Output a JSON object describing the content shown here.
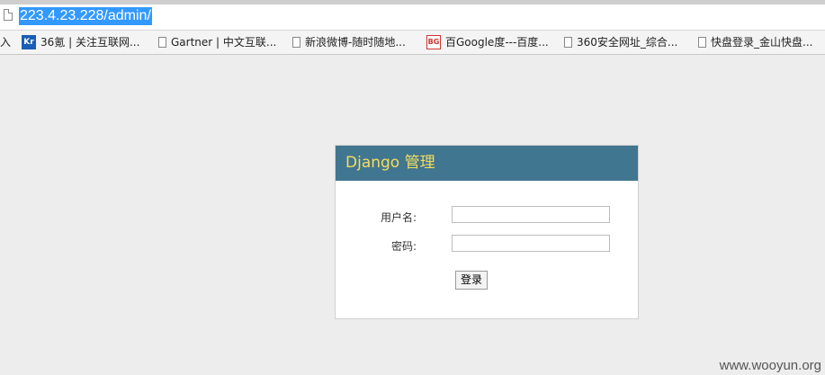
{
  "address_bar": {
    "url": "223.4.23.228/admin/"
  },
  "bookmarks": {
    "lead_text": "入",
    "items": [
      {
        "label": "36氪 | 关注互联网...",
        "icon": "kr-icon"
      },
      {
        "label": "Gartner | 中文互联...",
        "icon": "page-icon"
      },
      {
        "label": "新浪微博-随时随地...",
        "icon": "page-icon"
      },
      {
        "label": "百Google度---百度...",
        "icon": "bg-icon"
      },
      {
        "label": "360安全网址_综合...",
        "icon": "page-icon"
      },
      {
        "label": "快盘登录_金山快盘...",
        "icon": "page-icon"
      }
    ]
  },
  "login": {
    "title": "Django 管理",
    "username_label": "用户名:",
    "username_value": "",
    "password_label": "密码:",
    "password_value": "",
    "submit_label": "登录"
  },
  "watermark": "www.wooyun.org",
  "colors": {
    "header_bg": "#417690",
    "header_text": "#f5dd5d",
    "url_highlight": "#3399ff"
  }
}
